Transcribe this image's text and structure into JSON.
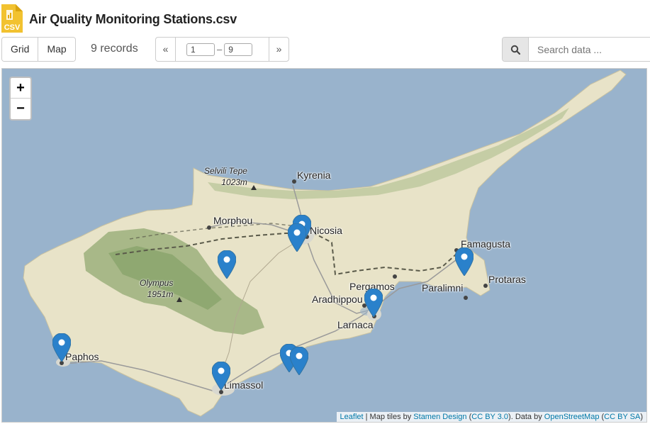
{
  "header": {
    "title": "Air Quality Monitoring Stations.csv",
    "icon": "csv-file-icon",
    "icon_text": "CSV"
  },
  "toolbar": {
    "views": [
      "Grid",
      "Map"
    ],
    "records": "9 records",
    "pager": {
      "prev": "«",
      "next": "»",
      "from": "1",
      "to": "9",
      "dash": "–"
    },
    "search": {
      "placeholder": "Search data ...",
      "icon": "search-icon"
    }
  },
  "map": {
    "zoom_in": "+",
    "zoom_out": "−",
    "attribution": {
      "leaflet": "Leaflet",
      "t1": " | Map tiles by ",
      "stamen": "Stamen Design",
      "l1": "CC BY 3.0",
      "t2": ". Data by ",
      "osm": "OpenStreetMap",
      "l2": "CC BY SA"
    },
    "places": [
      "Kyrenia",
      "Morphou",
      "Nicosia",
      "Famagusta",
      "Protaras",
      "Paralimni",
      "Pergamos",
      "Aradhippou",
      "Larnaca",
      "Paphos",
      "Limassol"
    ],
    "peaks": [
      {
        "name": "Selvili Tepe",
        "elev": "1023m"
      },
      {
        "name": "Olympus",
        "elev": "1951m"
      }
    ],
    "station_markers": 9,
    "colors": {
      "sea": "#99b3cc",
      "land": "#e8e3c8",
      "mountains": "#9cb07c",
      "marker": "#2a81cb",
      "border": "#5a5a4a"
    }
  }
}
